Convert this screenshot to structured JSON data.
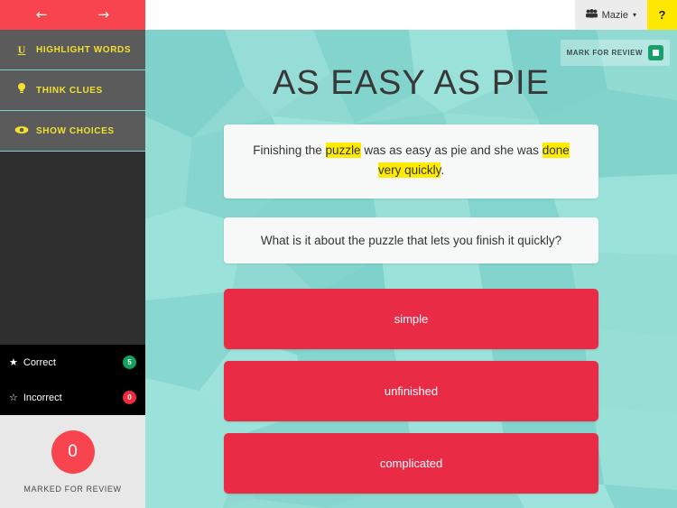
{
  "sidebar": {
    "nav": {
      "prev_icon": "arrow-left-icon",
      "prev_label": "←",
      "next_label": "→"
    },
    "tools": [
      {
        "icon": "underline-u-icon",
        "glyph": "U",
        "label": "HIGHLIGHT WORDS"
      },
      {
        "icon": "lightbulb-icon",
        "glyph": "¡",
        "label": "THINK CLUES"
      },
      {
        "icon": "eye-icon",
        "glyph": "◉",
        "label": "SHOW CHOICES"
      }
    ],
    "stats": [
      {
        "icon": "star-filled-icon",
        "glyph": "★",
        "label": "Correct",
        "count": "5",
        "color": "#12a05c"
      },
      {
        "icon": "star-outline-icon",
        "glyph": "☆",
        "label": "Incorrect",
        "count": "0",
        "color": "#ef2a3c"
      }
    ],
    "review": {
      "count": "0",
      "caption": "MARKED FOR REVIEW",
      "color": "#f7444e"
    }
  },
  "topbar": {
    "user_icon": "group-people-icon",
    "user_glyph": "👥",
    "user_name": "Mazie",
    "caret": "▾",
    "help_label": "?",
    "help_color": "#ffe800"
  },
  "main": {
    "mark_for_review": {
      "label": "MARK FOR REVIEW",
      "icon": "stop-square-icon",
      "color": "#17a06a"
    },
    "title": "AS EASY AS PIE",
    "sentence": {
      "parts": [
        {
          "text": "Finishing the ",
          "highlight": false
        },
        {
          "text": "puzzle",
          "highlight": true
        },
        {
          "text": " was as easy as pie and she was ",
          "highlight": false
        },
        {
          "text": "done very quickly",
          "highlight": true
        },
        {
          "text": ".",
          "highlight": false
        }
      ]
    },
    "question": "What is it about the puzzle that lets you finish it quickly?",
    "choices": [
      {
        "label": "simple"
      },
      {
        "label": "unfinished"
      },
      {
        "label": "complicated"
      }
    ],
    "accent_color": "#ea2b46",
    "background_color": "#8fd9d2"
  }
}
